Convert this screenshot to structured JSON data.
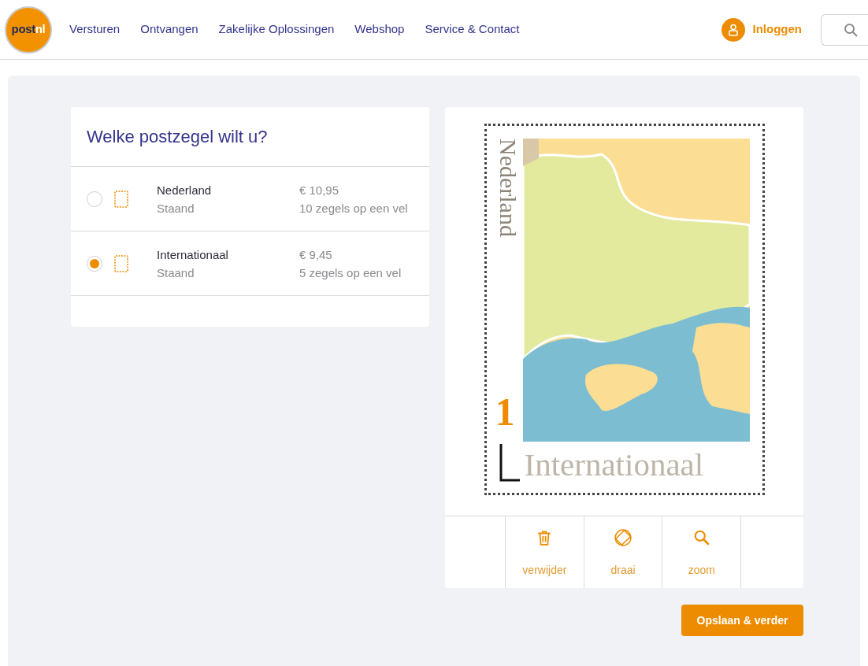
{
  "header": {
    "logo": [
      "post",
      "nl"
    ],
    "nav": [
      "Versturen",
      "Ontvangen",
      "Zakelijke Oplossingen",
      "Webshop",
      "Service & Contact"
    ],
    "login": "Inloggen"
  },
  "chooser": {
    "title": "Welke postzegel wilt u?",
    "options": [
      {
        "name": "Nederland",
        "orientation": "Staand",
        "price": "€ 10,95",
        "sheet": "10 zegels op een vel",
        "selected": false
      },
      {
        "name": "Internationaal",
        "orientation": "Staand",
        "price": "€ 9,45",
        "sheet": "5 zegels op een vel",
        "selected": true
      }
    ]
  },
  "stamp": {
    "country": "Nederland",
    "value": "1",
    "type": "Internationaal"
  },
  "tools": [
    {
      "kind": "delete",
      "label": "verwijder"
    },
    {
      "kind": "rotate",
      "label": "draai"
    },
    {
      "kind": "zoom",
      "label": "zoom"
    }
  ],
  "save_button": "Opslaan & verder"
}
